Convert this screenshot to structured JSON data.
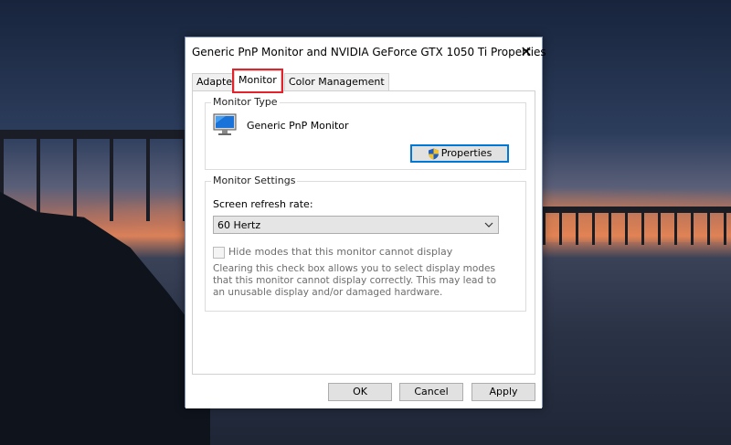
{
  "window": {
    "title": "Generic PnP Monitor and NVIDIA GeForce GTX 1050 Ti Properties",
    "close_glyph": "✕"
  },
  "tabs": [
    {
      "label": "Adapter",
      "active": false
    },
    {
      "label": "Monitor",
      "active": true
    },
    {
      "label": "Color Management",
      "active": false
    }
  ],
  "monitor_type": {
    "group_label": "Monitor Type",
    "monitor_name": "Generic PnP Monitor",
    "properties_button": "Properties"
  },
  "monitor_settings": {
    "group_label": "Monitor Settings",
    "refresh_label": "Screen refresh rate:",
    "refresh_value": "60 Hertz",
    "hide_modes_label": "Hide modes that this monitor cannot display",
    "hide_modes_checked": false,
    "description": "Clearing this check box allows you to select display modes that this monitor cannot display correctly. This may lead to an unusable display and/or damaged hardware."
  },
  "footer": {
    "ok": "OK",
    "cancel": "Cancel",
    "apply": "Apply"
  },
  "colors": {
    "highlight_box": "#e3222c",
    "focus_border": "#0078d7",
    "disabled_text": "#6d6d6d"
  }
}
